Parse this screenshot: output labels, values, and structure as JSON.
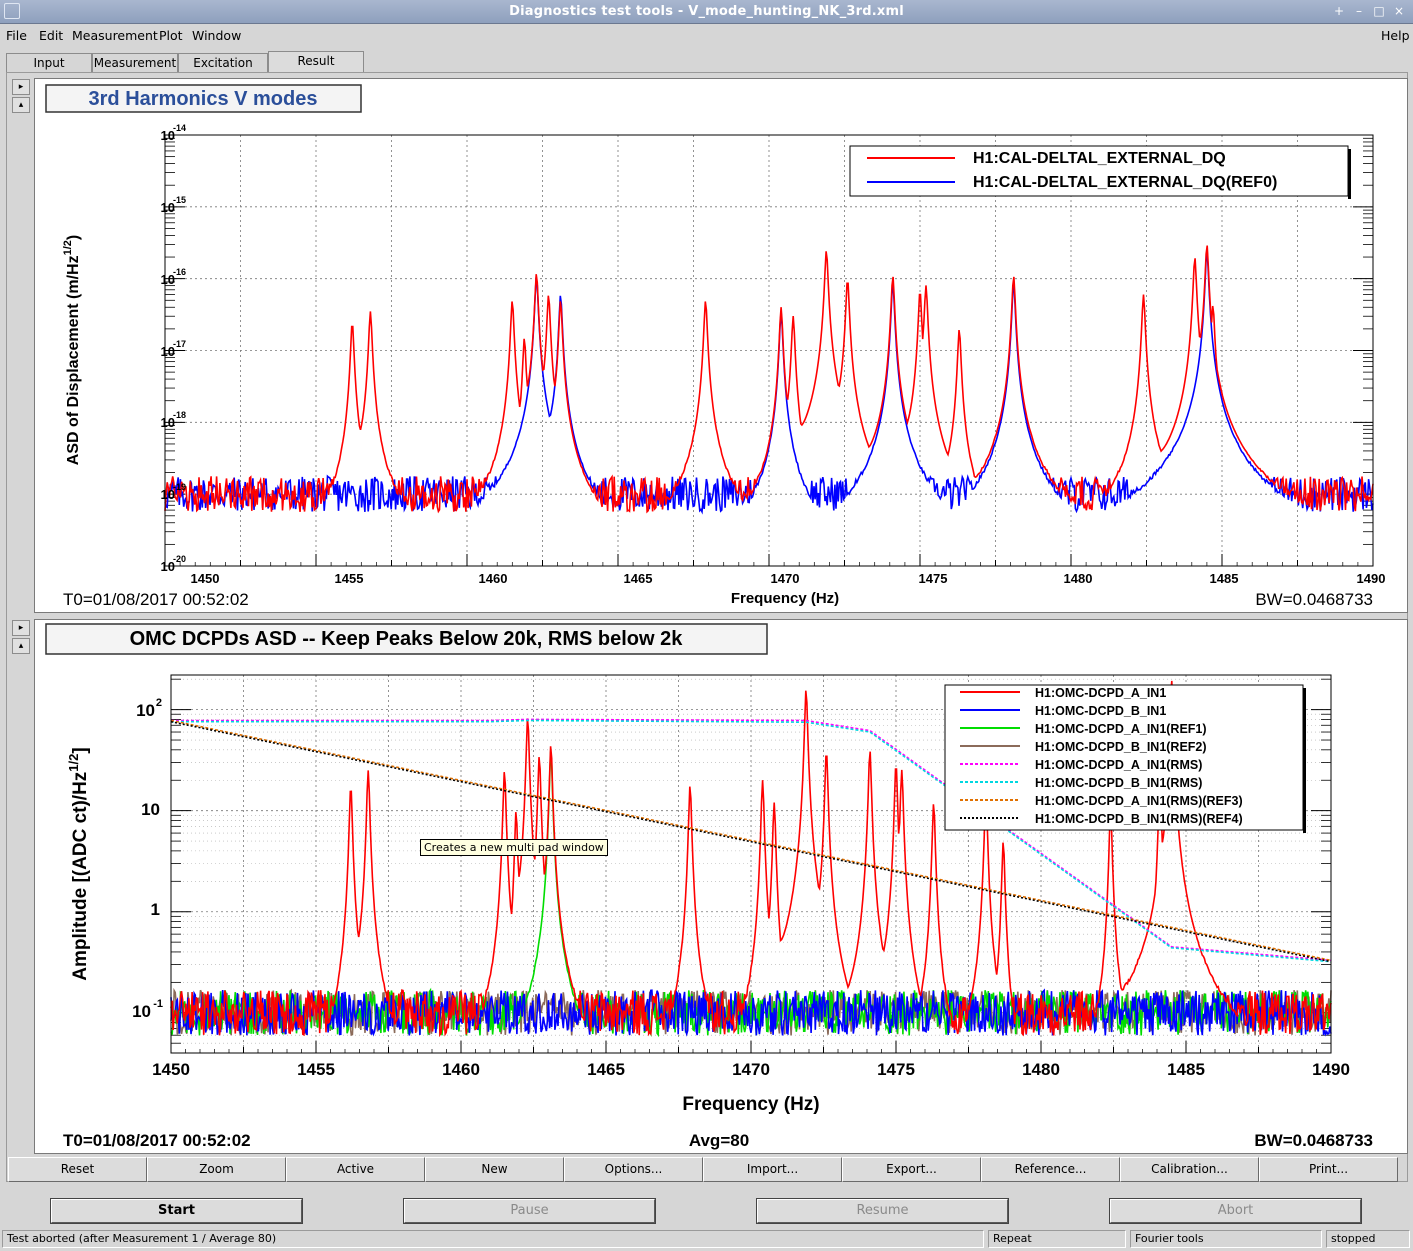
{
  "window": {
    "title": "Diagnostics test tools - V_mode_hunting_NK_3rd.xml",
    "controls": [
      "+",
      "–",
      "□",
      "×"
    ]
  },
  "menu": {
    "file": "File",
    "edit": "Edit",
    "measurement": "Measurement",
    "plot": "Plot",
    "window": "Window",
    "help": "Help"
  },
  "tabs": {
    "input": "Input",
    "measurement": "Measurement",
    "excitation": "Excitation",
    "result": "Result",
    "active": "Result"
  },
  "pad_controls": {
    "expand": "▸",
    "collapse": "▴"
  },
  "tooltip": "Creates a new multi pad window",
  "plot1": {
    "title": "3rd Harmonics V modes",
    "ylabel_main": "ASD of Displacement  (m/Hz",
    "ylabel_sup": "1/2",
    "ylabel_end": ")",
    "xlabel": "Frequency (Hz)",
    "t0": "T0=01/08/2017 00:52:02",
    "bw": "BW=0.0468733",
    "legend": [
      "H1:CAL-DELTAL_EXTERNAL_DQ",
      "H1:CAL-DELTAL_EXTERNAL_DQ(REF0)"
    ],
    "xticks": [
      "1450",
      "1455",
      "1460",
      "1465",
      "1470",
      "1475",
      "1480",
      "1485",
      "1490"
    ],
    "ytick_mantissa": [
      "10",
      "10",
      "10",
      "10",
      "10",
      "10",
      "10"
    ],
    "ytick_exponents": [
      "-14",
      "-15",
      "-16",
      "-17",
      "-18",
      "-19",
      "-20"
    ]
  },
  "plot2": {
    "title": "OMC DCPDs ASD -- Keep Peaks Below 20k, RMS below 2k",
    "ylabel_main": "Amplitude [(ADC ct)/Hz",
    "ylabel_sup": "1/2",
    "ylabel_end": "]",
    "xlabel": "Frequency (Hz)",
    "t0": "T0=01/08/2017 00:52:02",
    "avg": "Avg=80",
    "bw": "BW=0.0468733",
    "legend": [
      "H1:OMC-DCPD_A_IN1",
      "H1:OMC-DCPD_B_IN1",
      "H1:OMC-DCPD_A_IN1(REF1)",
      "H1:OMC-DCPD_B_IN1(REF2)",
      "H1:OMC-DCPD_A_IN1(RMS)",
      "H1:OMC-DCPD_B_IN1(RMS)",
      "H1:OMC-DCPD_A_IN1(RMS)(REF3)",
      "H1:OMC-DCPD_B_IN1(RMS)(REF4)"
    ],
    "xticks": [
      "1450",
      "1455",
      "1460",
      "1465",
      "1470",
      "1475",
      "1480",
      "1485",
      "1490"
    ],
    "yticks_text": [
      "",
      "10",
      "1"
    ],
    "ytick_mantissa": [
      "10",
      "10"
    ],
    "ytick_exponents": [
      "2",
      "-1"
    ]
  },
  "buttons": [
    "Reset",
    "Zoom",
    "Active",
    "New",
    "Options...",
    "Import...",
    "Export...",
    "Reference...",
    "Calibration...",
    "Print..."
  ],
  "controls": {
    "start": "Start",
    "pause": "Pause",
    "resume": "Resume",
    "abort": "Abort"
  },
  "status": {
    "message": "Test aborted (after Measurement 1 / Average 80)",
    "mode": "Repeat",
    "tool": "Fourier tools",
    "state": "stopped"
  },
  "colors": {
    "red": "#ff0000",
    "blue": "#0000ff",
    "green": "#00dd00",
    "brown": "#8b6b5a",
    "magenta": "#ff00ff",
    "cyan": "#00d8e0",
    "orange": "#e07000",
    "black": "#000000",
    "title_blue": "#2b4f9a"
  },
  "chart_data": [
    {
      "type": "line",
      "title": "3rd Harmonics V modes",
      "xlabel": "Frequency (Hz)",
      "ylabel": "ASD of Displacement  (m/Hz^1/2)",
      "xlim": [
        1450,
        1490
      ],
      "ylim": [
        1e-20,
        1e-14
      ],
      "yscale": "log",
      "grid": true,
      "legend_position": "top-right",
      "baseline": 1e-19,
      "series": [
        {
          "name": "H1:CAL-DELTAL_EXTERNAL_DQ",
          "color": "#ff0000",
          "peaks_x": [
            1456.2,
            1456.8,
            1461.5,
            1461.9,
            1462.3,
            1462.7,
            1463.1,
            1467.9,
            1470.4,
            1470.8,
            1471.9,
            1472.6,
            1474.1,
            1475.0,
            1475.2,
            1476.3,
            1478.1,
            1482.4,
            1484.1,
            1484.5,
            1484.7
          ],
          "peaks_y": [
            2.5e-17,
            3.5e-17,
            5e-17,
            1.5e-17,
            1.2e-16,
            6e-17,
            5e-17,
            5e-17,
            4e-17,
            3e-17,
            2.5e-16,
            1e-16,
            1.1e-16,
            7e-17,
            8e-17,
            2e-17,
            1.1e-16,
            6e-17,
            2e-16,
            3e-16,
            4e-17
          ]
        },
        {
          "name": "H1:CAL-DELTAL_EXTERNAL_DQ(REF0)",
          "color": "#0000ff",
          "peaks_x": [
            1462.3,
            1463.1,
            1470.4,
            1474.1,
            1478.1,
            1484.5
          ],
          "peaks_y": [
            1.1e-16,
            6e-17,
            3.5e-17,
            9e-17,
            9e-17,
            2.5e-16
          ]
        }
      ]
    },
    {
      "type": "line",
      "title": "OMC DCPDs ASD -- Keep Peaks Below 20k, RMS below 2k",
      "xlabel": "Frequency (Hz)",
      "ylabel": "Amplitude [(ADC ct)/Hz^1/2]",
      "xlim": [
        1450,
        1490
      ],
      "ylim": [
        0.04,
        220
      ],
      "yscale": "log",
      "grid": true,
      "legend_position": "top-right",
      "baseline": 0.1,
      "series": [
        {
          "name": "H1:OMC-DCPD_A_IN1",
          "color": "#ff0000",
          "peaks_x": [
            1456.2,
            1456.8,
            1461.5,
            1461.9,
            1462.3,
            1462.7,
            1463.1,
            1467.9,
            1470.4,
            1470.8,
            1471.9,
            1472.6,
            1474.1,
            1475.0,
            1475.2,
            1476.3,
            1478.1,
            1478.7,
            1482.4,
            1484.1,
            1484.5
          ],
          "peaks_y": [
            18,
            25,
            25,
            10,
            85,
            35,
            45,
            18,
            20,
            12,
            160,
            40,
            40,
            30,
            25,
            12,
            15,
            5,
            10,
            20,
            200
          ]
        },
        {
          "name": "H1:OMC-DCPD_B_IN1",
          "color": "#0000ff",
          "peaks_x": [],
          "peaks_y": []
        },
        {
          "name": "H1:OMC-DCPD_A_IN1(REF1)",
          "color": "#00dd00",
          "peaks_x": [
            1463.1
          ],
          "peaks_y": [
            40
          ]
        },
        {
          "name": "H1:OMC-DCPD_B_IN1(REF2)",
          "color": "#8b6b5a",
          "peaks_x": [],
          "peaks_y": []
        },
        {
          "name": "H1:OMC-DCPD_A_IN1(RMS)",
          "color": "#ff00ff",
          "x": [
            1450,
            1461.0,
            1462.3,
            1471.9,
            1474.1,
            1484.5,
            1490
          ],
          "y": [
            78,
            78,
            80,
            78,
            62,
            0.45,
            0.33
          ]
        },
        {
          "name": "H1:OMC-DCPD_B_IN1(RMS)",
          "color": "#00d8e0",
          "x": [
            1450,
            1461.0,
            1462.3,
            1471.9,
            1474.1,
            1484.5,
            1490
          ],
          "y": [
            76,
            76,
            78,
            75,
            60,
            0.44,
            0.32
          ]
        },
        {
          "name": "H1:OMC-DCPD_A_IN1(RMS)(REF3)",
          "color": "#e07000",
          "x": [
            1450,
            1490
          ],
          "y": [
            78,
            0.33
          ]
        },
        {
          "name": "H1:OMC-DCPD_B_IN1(RMS)(REF4)",
          "color": "#000000",
          "x": [
            1450,
            1490
          ],
          "y": [
            76,
            0.32
          ]
        }
      ]
    }
  ]
}
